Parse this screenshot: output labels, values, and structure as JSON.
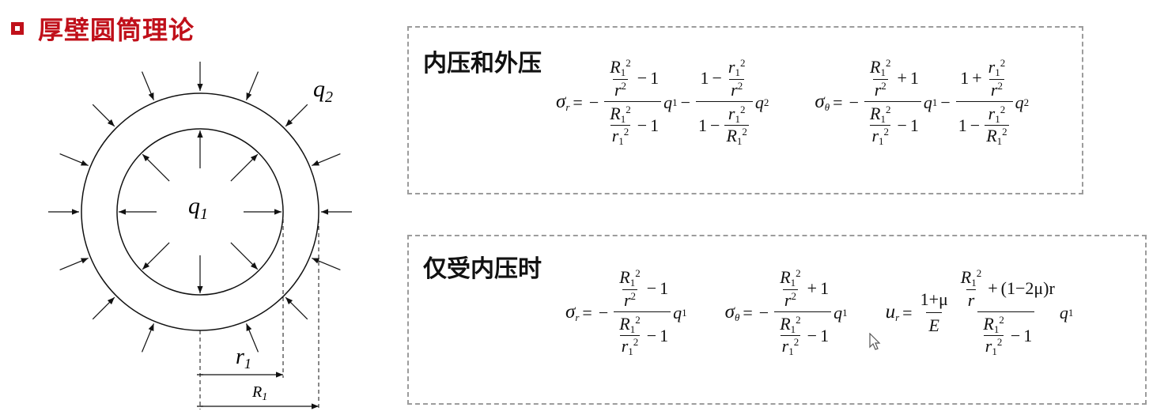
{
  "header": {
    "title": "厚壁圆筒理论",
    "accent_color": "#c0101a"
  },
  "figure": {
    "outer_pressure_label": "q",
    "outer_pressure_sub": "2",
    "inner_pressure_label": "q",
    "inner_pressure_sub": "1",
    "inner_radius_label": "r",
    "inner_radius_sub": "1",
    "outer_radius_label": "R",
    "outer_radius_sub": "1"
  },
  "box1": {
    "title": "内压和外压",
    "sigma_r_symbol": "σ",
    "sigma_r_sub": "r",
    "sigma_theta_symbol": "σ",
    "sigma_theta_sub": "θ"
  },
  "box2": {
    "title": "仅受内压时",
    "sigma_r_symbol": "σ",
    "sigma_r_sub": "r",
    "sigma_theta_symbol": "σ",
    "sigma_theta_sub": "θ",
    "u_symbol": "u",
    "u_sub": "r",
    "mu_term": "(1−2μ)r",
    "one_plus_mu": "1+μ",
    "modulus": "E"
  },
  "icons": {
    "cursor": "mouse-pointer-icon"
  }
}
